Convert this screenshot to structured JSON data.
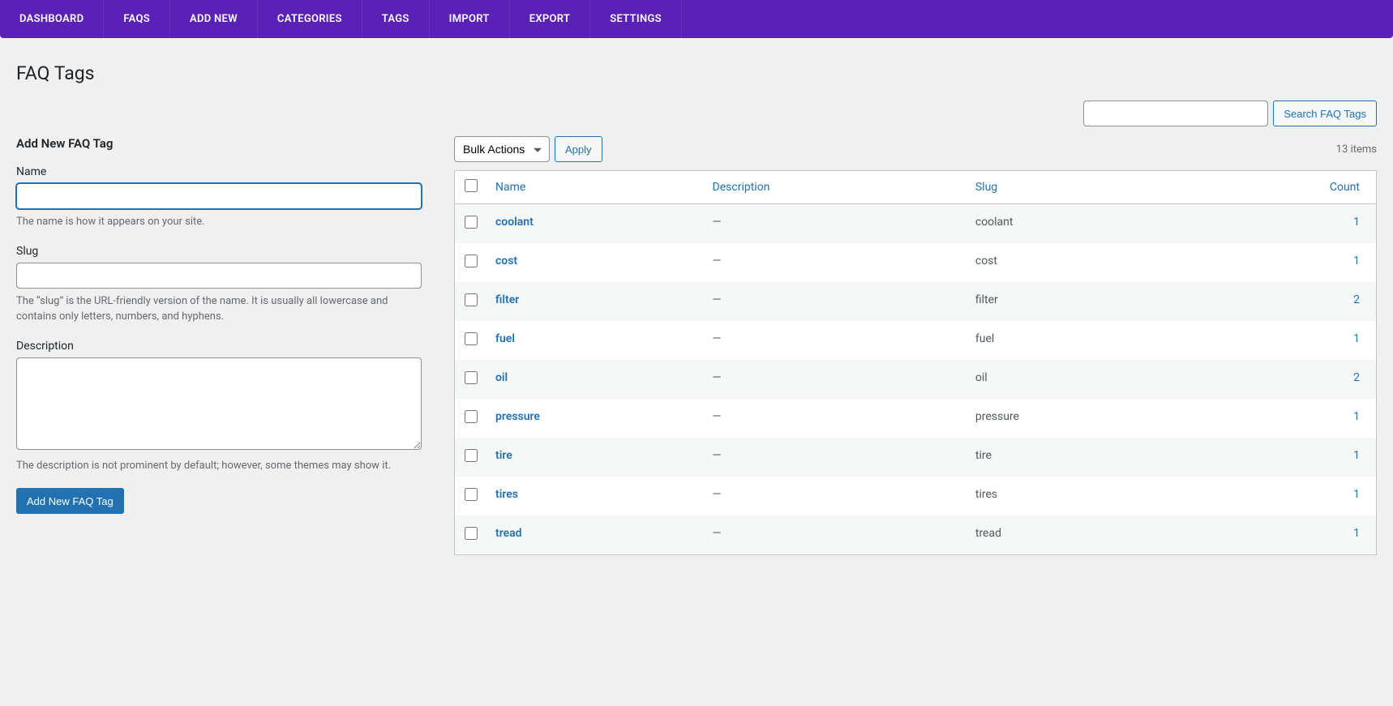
{
  "nav": {
    "items": [
      {
        "label": "DASHBOARD"
      },
      {
        "label": "FAQS"
      },
      {
        "label": "ADD NEW"
      },
      {
        "label": "CATEGORIES"
      },
      {
        "label": "TAGS"
      },
      {
        "label": "IMPORT"
      },
      {
        "label": "EXPORT"
      },
      {
        "label": "SETTINGS"
      }
    ]
  },
  "page": {
    "title": "FAQ Tags"
  },
  "search": {
    "button_label": "Search FAQ Tags"
  },
  "form": {
    "section_title": "Add New FAQ Tag",
    "name_label": "Name",
    "name_help": "The name is how it appears on your site.",
    "slug_label": "Slug",
    "slug_help": "The “slug” is the URL-friendly version of the name. It is usually all lowercase and contains only letters, numbers, and hyphens.",
    "description_label": "Description",
    "description_help": "The description is not prominent by default; however, some themes may show it.",
    "submit_label": "Add New FAQ Tag"
  },
  "tablenav": {
    "bulk_label": "Bulk Actions",
    "apply_label": "Apply",
    "items_count": "13 items"
  },
  "table": {
    "headers": {
      "name": "Name",
      "description": "Description",
      "slug": "Slug",
      "count": "Count"
    },
    "rows": [
      {
        "name": "coolant",
        "description": "—",
        "slug": "coolant",
        "count": "1"
      },
      {
        "name": "cost",
        "description": "—",
        "slug": "cost",
        "count": "1"
      },
      {
        "name": "filter",
        "description": "—",
        "slug": "filter",
        "count": "2"
      },
      {
        "name": "fuel",
        "description": "—",
        "slug": "fuel",
        "count": "1"
      },
      {
        "name": "oil",
        "description": "—",
        "slug": "oil",
        "count": "2"
      },
      {
        "name": "pressure",
        "description": "—",
        "slug": "pressure",
        "count": "1"
      },
      {
        "name": "tire",
        "description": "—",
        "slug": "tire",
        "count": "1"
      },
      {
        "name": "tires",
        "description": "—",
        "slug": "tires",
        "count": "1"
      },
      {
        "name": "tread",
        "description": "—",
        "slug": "tread",
        "count": "1"
      }
    ]
  }
}
